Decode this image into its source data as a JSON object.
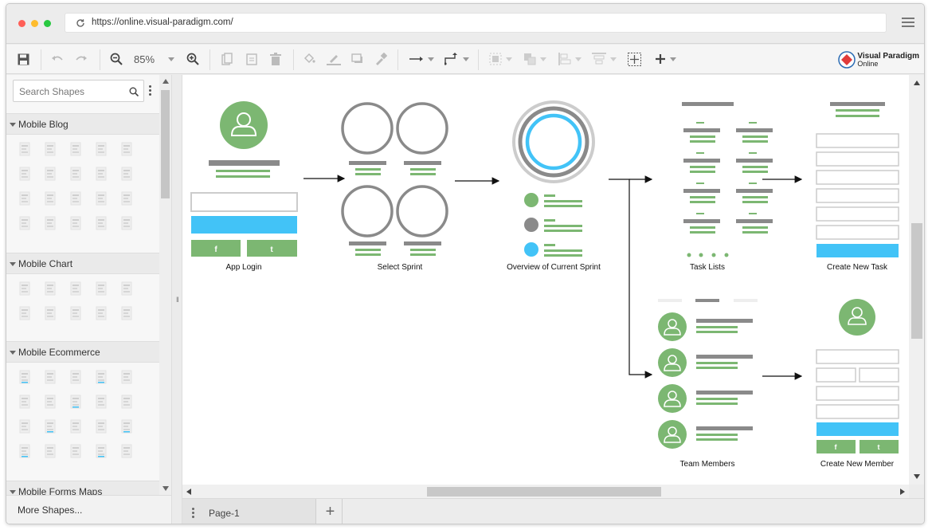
{
  "browser": {
    "url": "https://online.visual-paradigm.com/",
    "traffic_lights": [
      "#ff5f57",
      "#febc2e",
      "#28c840"
    ]
  },
  "toolbar": {
    "zoom": "85%"
  },
  "logo": {
    "line1": "Visual Paradigm",
    "line2": "Online"
  },
  "sidebar": {
    "search_placeholder": "Search Shapes",
    "categories": [
      {
        "label": "Mobile Blog"
      },
      {
        "label": "Mobile Chart"
      },
      {
        "label": "Mobile Ecommerce"
      },
      {
        "label": "Mobile Forms Maps"
      }
    ],
    "more_shapes": "More Shapes..."
  },
  "diagram": {
    "labels": {
      "app_login": "App Login",
      "select_sprint": "Select Sprint",
      "overview": "Overview of Current Sprint",
      "task_lists": "Task Lists",
      "create_task": "Create New Task",
      "team_members": "Team Members",
      "create_member": "Create New Member"
    },
    "social": {
      "facebook": "f",
      "twitter": "t"
    },
    "colors": {
      "green": "#7cb772",
      "blue": "#42c3f7",
      "gray": "#8a8a8a"
    }
  },
  "pages": {
    "current": "Page-1"
  }
}
